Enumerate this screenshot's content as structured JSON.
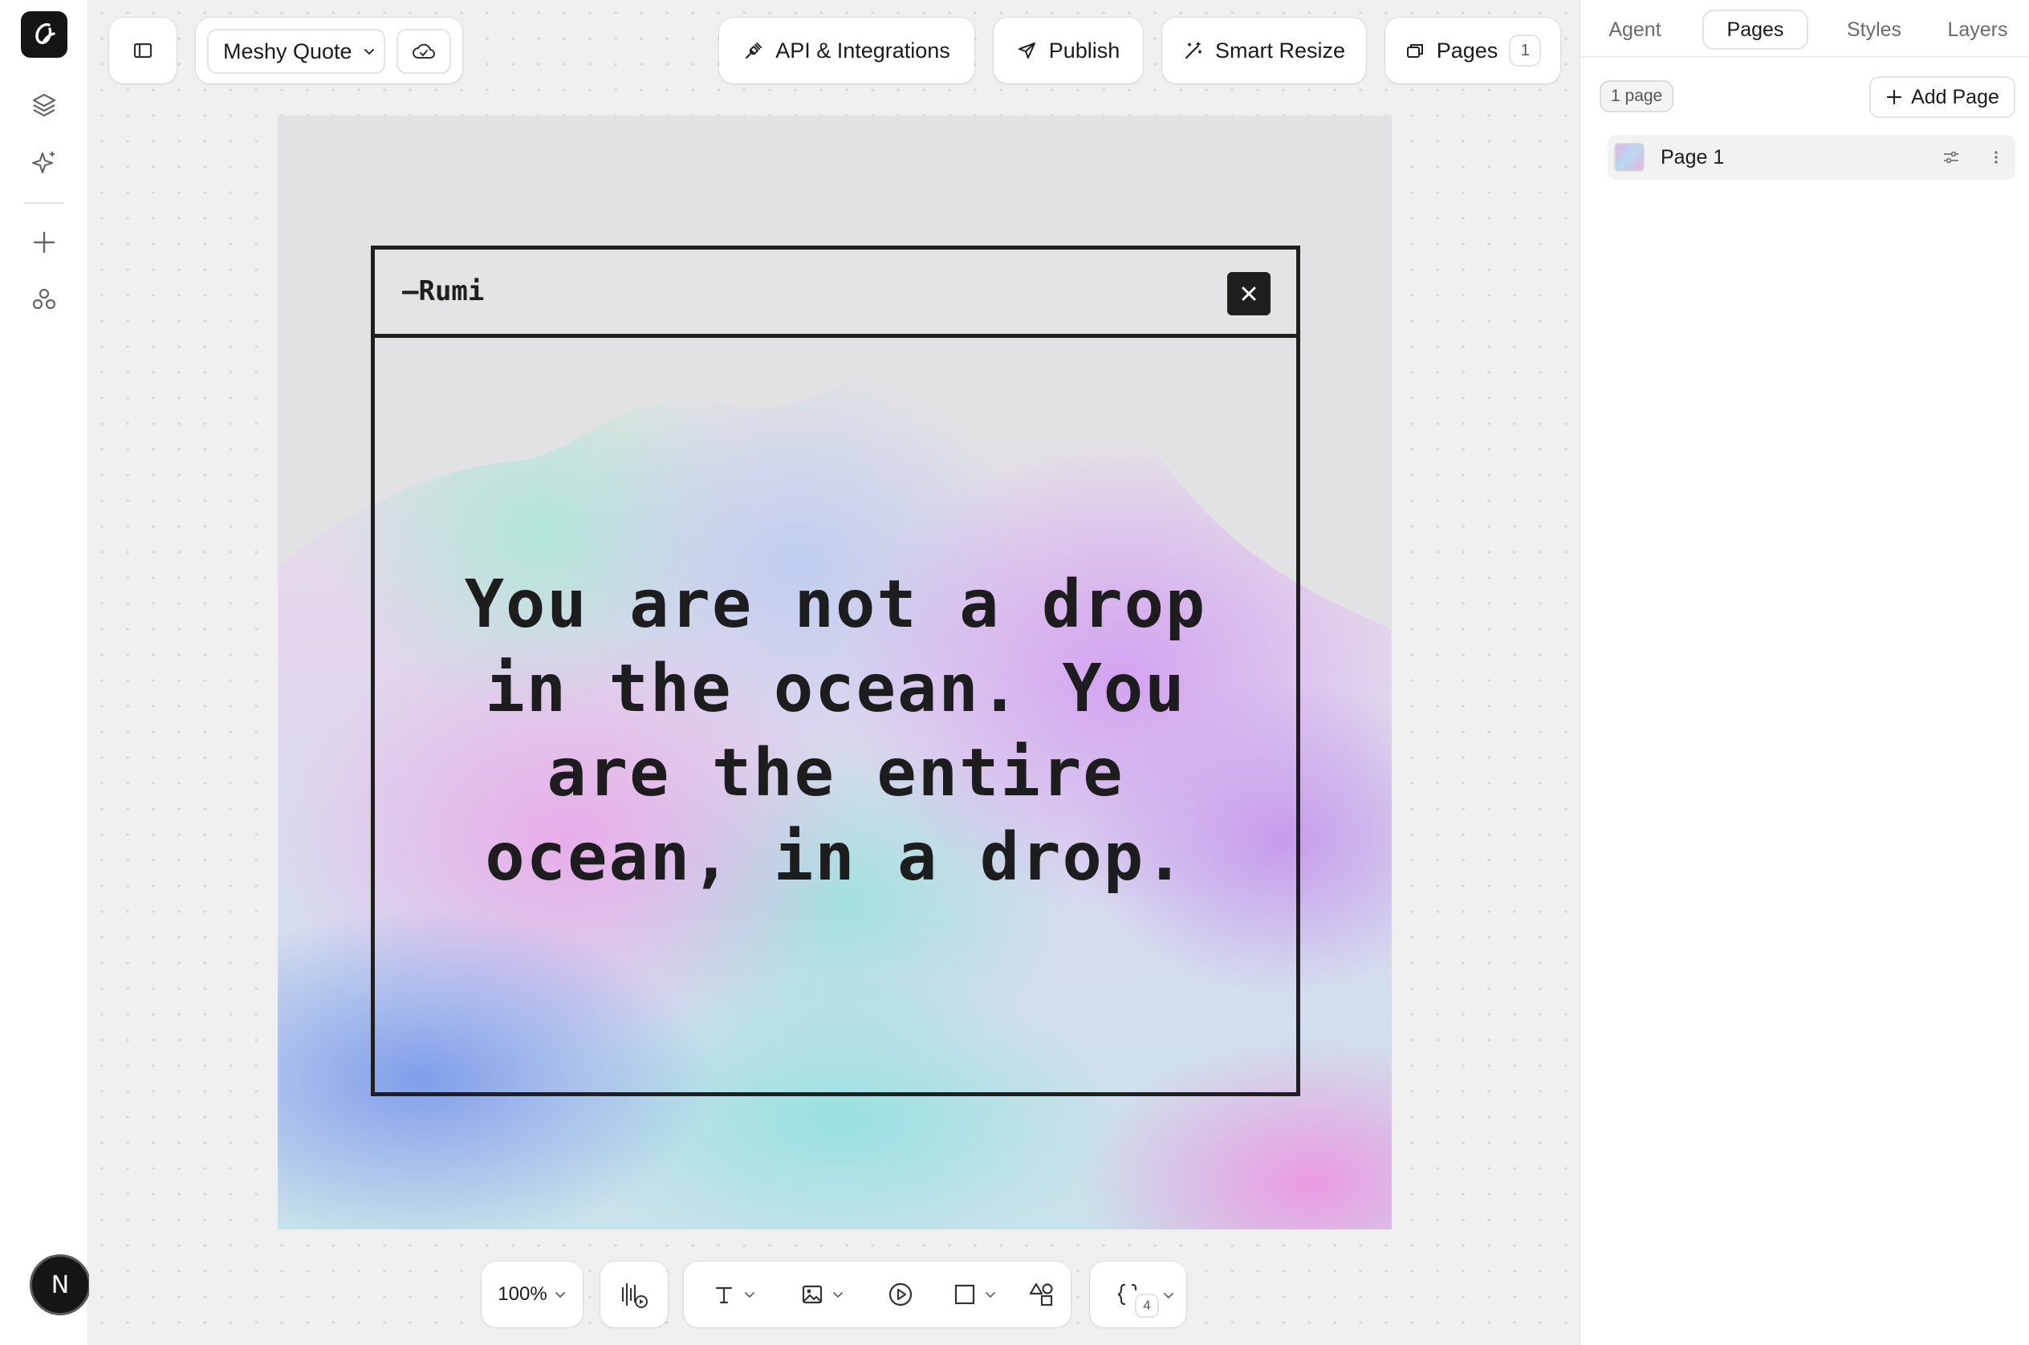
{
  "toolbar": {
    "project_name": "Meshy Quote",
    "api_label": "API & Integrations",
    "publish_label": "Publish",
    "smart_resize_label": "Smart Resize",
    "pages_label": "Pages",
    "pages_count": "1"
  },
  "user": {
    "initial": "N"
  },
  "artboard": {
    "author": "—Rumi",
    "quote_lines": [
      "You are not a drop",
      "in the ocean. You",
      "are the entire",
      "ocean, in a drop."
    ]
  },
  "bottom_toolbar": {
    "zoom": "100%",
    "variables_count": "4"
  },
  "right_panel": {
    "tabs": [
      "Agent",
      "Pages",
      "Styles",
      "Layers"
    ],
    "active_tab": "Pages",
    "page_count_label": "1 page",
    "add_page_label": "Add Page",
    "pages": [
      {
        "name": "Page 1"
      }
    ]
  },
  "colors": {
    "canvas_bg": "#efefef",
    "ink": "#1f1f1f",
    "panel_bg": "#ffffff"
  }
}
